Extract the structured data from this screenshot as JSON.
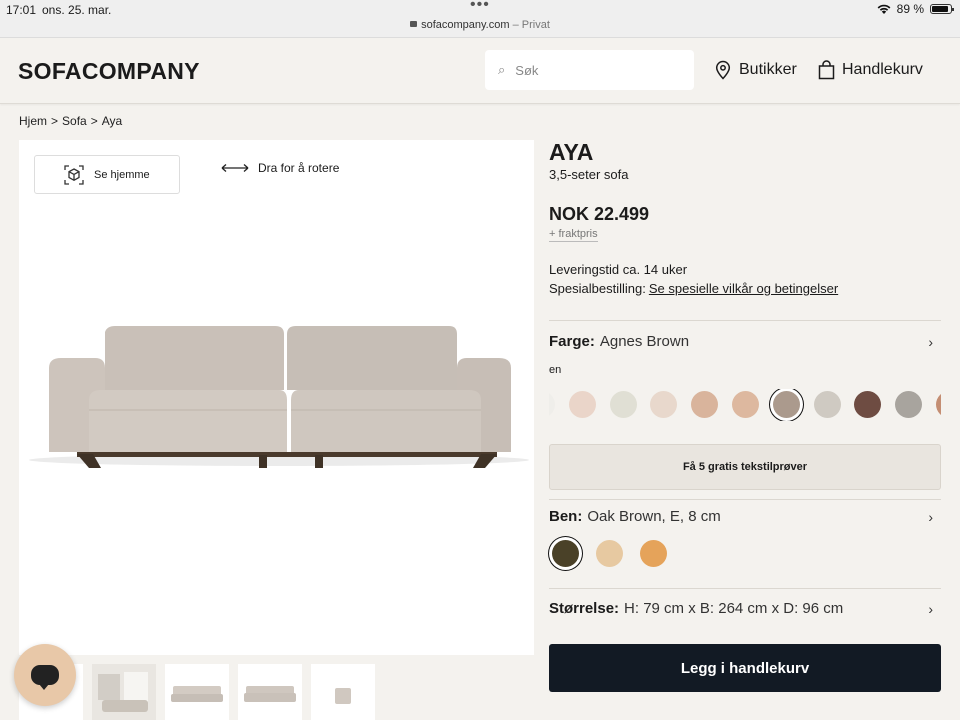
{
  "status_bar": {
    "time": "17:01",
    "date": "ons. 25. mar.",
    "url": "sofacompany.com",
    "private_label": "Privat",
    "battery": "89 %",
    "battery_level": 0.89
  },
  "header": {
    "logo": "SOFACOMPANY",
    "search_placeholder": "Søk",
    "stores_label": "Butikker",
    "cart_label": "Handlekurv"
  },
  "breadcrumb": [
    "Hjem",
    ">",
    "Sofa",
    ">",
    "Aya"
  ],
  "viewer": {
    "ar_label": "Se hjemme",
    "rotate_label": "Dra for å rotere"
  },
  "product": {
    "name": "AYA",
    "subtitle": "3,5-seter sofa",
    "price": "NOK 22.499",
    "freight": "+ fraktpris",
    "delivery": "Leveringstid ca. 14 uker",
    "special_label": "Spesialbestilling:",
    "special_link": "Se spesielle vilkår og betingelser"
  },
  "color_option": {
    "label": "Farge:",
    "value": "Agnes Brown",
    "language_note": "en",
    "swatches": [
      "#efeeea",
      "#ead5c9",
      "#e0dfd4",
      "#e8d8cc",
      "#d9b49c",
      "#ddb89f",
      "#ab9a8d",
      "#cfcac2",
      "#6e4c42",
      "#a8a49e",
      "#c48e73"
    ],
    "selected_index": 6,
    "samples_button": "Få 5 gratis tekstilprøver"
  },
  "legs_option": {
    "label": "Ben:",
    "value": "Oak Brown, E, 8 cm",
    "swatches": [
      "#4a4128",
      "#e7c9a1",
      "#e5a35a"
    ],
    "selected_index": 0
  },
  "size_option": {
    "label": "Størrelse:",
    "value": "H: 79 cm x B: 264 cm x D: 96 cm"
  },
  "add_to_cart": "Legg i handlekurv"
}
